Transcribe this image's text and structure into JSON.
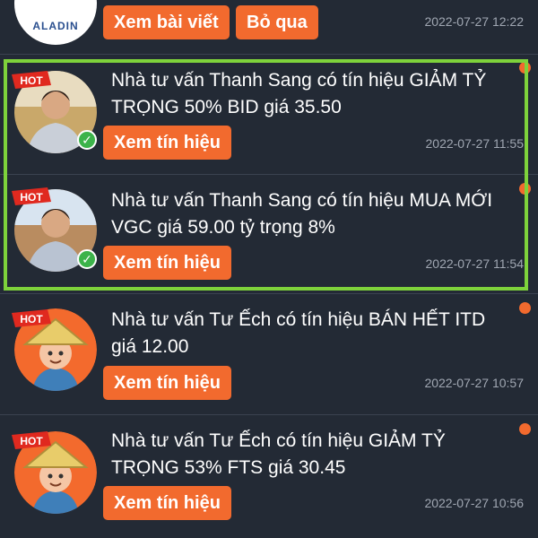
{
  "top_row": {
    "logo_text": "ALADIN",
    "buttons": [
      "Xem bài viết",
      "Bỏ qua"
    ],
    "time": "2022-07-27 12:22"
  },
  "badge_text": "HOT",
  "notifications": [
    {
      "message": "Nhà tư vấn Thanh Sang có tín hiệu GIẢM TỶ TRỌNG 50% BID giá 35.50",
      "button": "Xem tín hiệu",
      "time": "2022-07-27 11:55",
      "avatar": "photo-man-icon",
      "verified": true,
      "unread": true
    },
    {
      "message": "Nhà tư vấn Thanh Sang có tín hiệu MUA MỚI VGC giá 59.00 tỷ trọng 8%",
      "button": "Xem tín hiệu",
      "time": "2022-07-27 11:54",
      "avatar": "photo-man-icon",
      "verified": true,
      "unread": true
    },
    {
      "message": "Nhà tư vấn Tư Ếch có tín hiệu BÁN HẾT ITD giá 12.00",
      "button": "Xem tín hiệu",
      "time": "2022-07-27 10:57",
      "avatar": "cartoon-farmer-icon",
      "verified": false,
      "unread": true
    },
    {
      "message": "Nhà tư vấn Tư Ếch có tín hiệu GIẢM TỶ TRỌNG 53% FTS giá 30.45",
      "button": "Xem tín hiệu",
      "time": "2022-07-27 10:56",
      "avatar": "cartoon-farmer-icon",
      "verified": false,
      "unread": true
    }
  ],
  "colors": {
    "background": "#1f2631",
    "accent": "#f26a2e",
    "highlight_border": "#7ed23b",
    "verified": "#3cb34a",
    "time_text": "#a0a7b2"
  }
}
